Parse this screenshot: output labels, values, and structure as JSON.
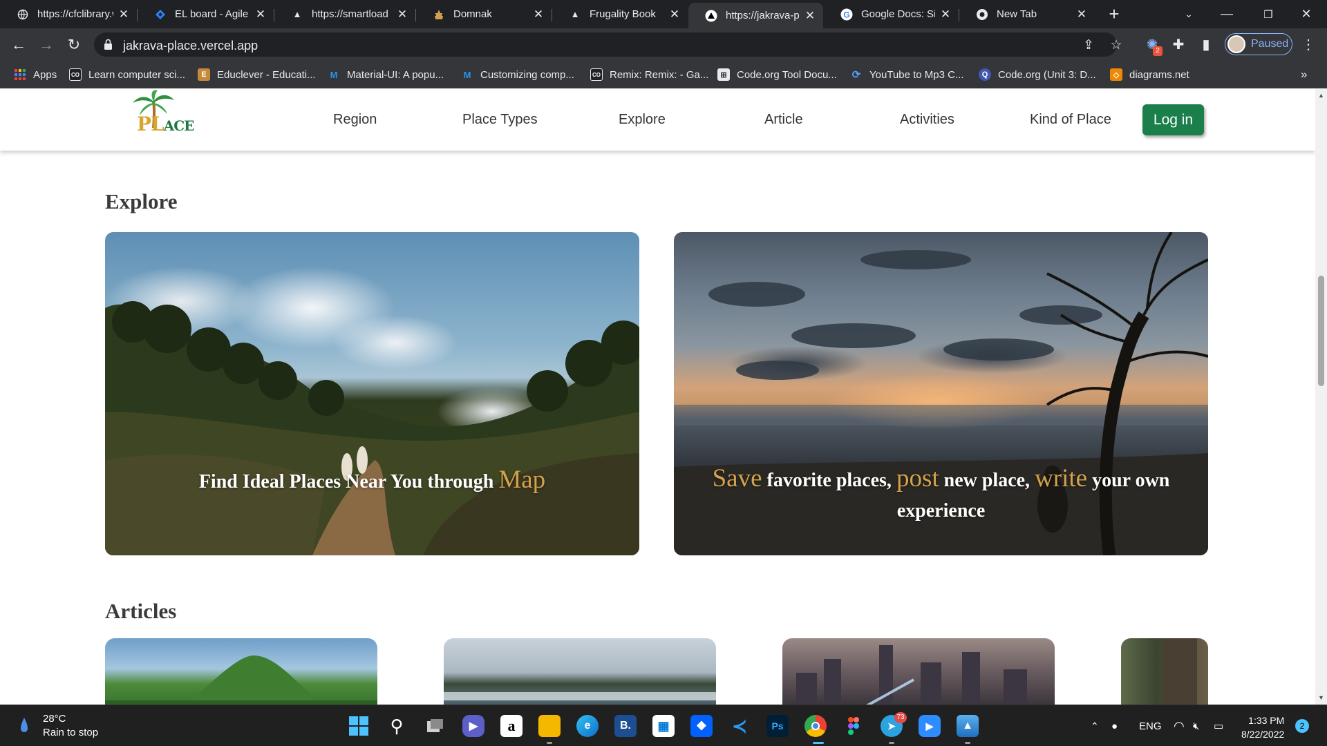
{
  "browser": {
    "tabs": [
      {
        "title": "https://cfclibrary.w",
        "icon": "globe-icon"
      },
      {
        "title": "EL board - Agile b",
        "icon": "jira-icon"
      },
      {
        "title": "https://smartload",
        "icon": "triangle-icon"
      },
      {
        "title": "Domnak",
        "icon": "temple-icon"
      },
      {
        "title": "Frugality Book",
        "icon": "triangle-icon"
      },
      {
        "title": "https://jakrava-pl",
        "icon": "triangle-icon",
        "active": true
      },
      {
        "title": "Google Docs: Sign",
        "icon": "google-icon"
      },
      {
        "title": "New Tab",
        "icon": "chrome-icon"
      }
    ],
    "url": "jakrava-place.vercel.app",
    "profile_label": "Paused",
    "extension_badge": "2",
    "bookmarks": [
      {
        "label": "Apps",
        "icon": "apps-grid-icon"
      },
      {
        "label": "Learn computer sci...",
        "icon": "code-org-icon"
      },
      {
        "label": "Educlever - Educati...",
        "icon": "educlever-icon"
      },
      {
        "label": "Material-UI: A popu...",
        "icon": "mui-icon"
      },
      {
        "label": "Customizing comp...",
        "icon": "mui-icon"
      },
      {
        "label": "Remix: Remix: - Ga...",
        "icon": "code-org-icon"
      },
      {
        "label": "Code.org Tool Docu...",
        "icon": "code-org-tool-icon"
      },
      {
        "label": "YouTube to Mp3 C...",
        "icon": "yt-mp3-icon"
      },
      {
        "label": "Code.org (Unit 3: D...",
        "icon": "quizlet-icon"
      },
      {
        "label": "diagrams.net",
        "icon": "drawio-icon"
      }
    ],
    "bookmarks_more": "»"
  },
  "site": {
    "logo_text": "PL",
    "logo_suffix": "ACE",
    "nav": [
      "Region",
      "Place Types",
      "Explore",
      "Article",
      "Activities",
      "Kind of Place"
    ],
    "login_label": "Log in",
    "explore_title": "Explore",
    "cards": {
      "map": {
        "text": "Find Ideal Places Near You through",
        "highlight": "Map"
      },
      "save": {
        "h1": "Save",
        "t1": "favorite places,",
        "h2": "post",
        "t2": "new place,",
        "h3": "write",
        "t3": "your own experience"
      }
    },
    "articles_title": "Articles"
  },
  "taskbar": {
    "temperature": "28°C",
    "weather": "Rain to stop",
    "language": "ENG",
    "time": "1:33 PM",
    "date": "8/22/2022",
    "notifications": "2",
    "telegram_badge": "73",
    "apps": [
      "start-icon",
      "search-icon",
      "task-view-icon",
      "teams-chat-icon",
      "amazon-icon",
      "file-explorer-icon",
      "edge-icon",
      "b-app-icon",
      "store-icon",
      "dropbox-icon",
      "vscode-icon",
      "photoshop-icon",
      "chrome-icon",
      "figma-icon",
      "telegram-icon",
      "zoom-icon",
      "photos-icon"
    ]
  },
  "colors": {
    "accent_gold": "#d4a24a",
    "login_green": "#1a7f4b",
    "chrome_dark": "#202124",
    "chrome_toolbar": "#35363a"
  }
}
